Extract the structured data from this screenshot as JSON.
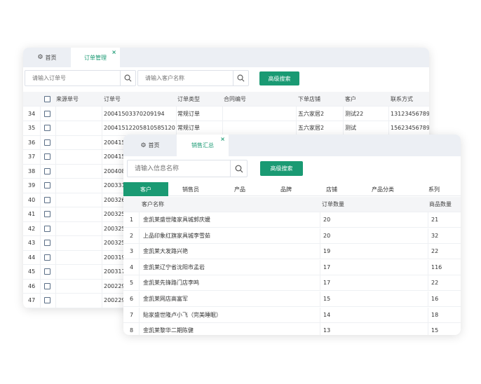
{
  "back_window": {
    "tabs": [
      {
        "label": "首页",
        "icon": "gear-icon",
        "active": false
      },
      {
        "label": "订单管理",
        "active": true,
        "closable": true
      }
    ],
    "order_search": {
      "placeholder": "请输入订单号"
    },
    "customer_search": {
      "placeholder": "请输入客户名称"
    },
    "advanced_search_label": "高级搜索",
    "table": {
      "columns": [
        "来源单号",
        "订单号",
        "订单类型",
        "合同编号",
        "下单店铺",
        "客户",
        "联系方式"
      ],
      "rows": [
        {
          "num": "34",
          "source": "",
          "order": "20041503370209194",
          "type": "常规订单",
          "contract": "",
          "store": "五六家居2",
          "customer": "测试22",
          "contact": "13123456789"
        },
        {
          "num": "35",
          "source": "",
          "order": "20041512205810585120 7",
          "type": "常规订单",
          "contract": "",
          "store": "五六家居2",
          "customer": "测试",
          "contact": "15623456789"
        },
        {
          "num": "36",
          "source": "",
          "order": "200415",
          "type": "",
          "contract": "",
          "store": "",
          "customer": "",
          "contact": ""
        },
        {
          "num": "37",
          "source": "",
          "order": "200415",
          "type": "",
          "contract": "",
          "store": "",
          "customer": "",
          "contact": ""
        },
        {
          "num": "38",
          "source": "",
          "order": "200408",
          "type": "",
          "contract": "",
          "store": "",
          "customer": "",
          "contact": ""
        },
        {
          "num": "39",
          "source": "",
          "order": "200331",
          "type": "",
          "contract": "",
          "store": "",
          "customer": "",
          "contact": ""
        },
        {
          "num": "40",
          "source": "",
          "order": "200326",
          "type": "",
          "contract": "",
          "store": "",
          "customer": "",
          "contact": ""
        },
        {
          "num": "41",
          "source": "",
          "order": "200325",
          "type": "",
          "contract": "",
          "store": "",
          "customer": "",
          "contact": ""
        },
        {
          "num": "42",
          "source": "",
          "order": "200325",
          "type": "",
          "contract": "",
          "store": "",
          "customer": "",
          "contact": ""
        },
        {
          "num": "43",
          "source": "",
          "order": "200325",
          "type": "",
          "contract": "",
          "store": "",
          "customer": "",
          "contact": ""
        },
        {
          "num": "44",
          "source": "",
          "order": "200319",
          "type": "",
          "contract": "",
          "store": "",
          "customer": "",
          "contact": ""
        },
        {
          "num": "45",
          "source": "",
          "order": "200317",
          "type": "",
          "contract": "",
          "store": "",
          "customer": "",
          "contact": ""
        },
        {
          "num": "46",
          "source": "",
          "order": "200229",
          "type": "",
          "contract": "",
          "store": "",
          "customer": "",
          "contact": ""
        },
        {
          "num": "47",
          "source": "",
          "order": "200229",
          "type": "",
          "contract": "",
          "store": "",
          "customer": "",
          "contact": ""
        }
      ]
    }
  },
  "front_window": {
    "tabs": [
      {
        "label": "首页",
        "icon": "gear-icon",
        "active": false
      },
      {
        "label": "销售汇总",
        "active": true,
        "closable": true
      }
    ],
    "search": {
      "placeholder": "请输入信息名称"
    },
    "advanced_search_label": "高级搜索",
    "subtabs": [
      "客户",
      "销售员",
      "产品",
      "品牌",
      "店铺",
      "产品分类",
      "系列"
    ],
    "active_subtab": 0,
    "table": {
      "columns": [
        "客户名称",
        "订单数量",
        "商品数量"
      ],
      "rows": [
        {
          "num": "1",
          "name": "金凯莱盛世隆家具城郭庆媛",
          "orders": "20",
          "items": "21"
        },
        {
          "num": "2",
          "name": "上品印象红旗家具城李雪茹",
          "orders": "20",
          "items": "32"
        },
        {
          "num": "3",
          "name": "金凯莱大发路兴艳",
          "orders": "19",
          "items": "22"
        },
        {
          "num": "4",
          "name": "金凯莱辽宁省沈阳市孟岩",
          "orders": "17",
          "items": "116"
        },
        {
          "num": "5",
          "name": "金凯莱先锋路门店李鸣",
          "orders": "17",
          "items": "22"
        },
        {
          "num": "6",
          "name": "金凯莱网店高富军",
          "orders": "15",
          "items": "16"
        },
        {
          "num": "7",
          "name": "貼家盛世隆卢小飞（完美睡眠）",
          "orders": "14",
          "items": "18"
        },
        {
          "num": "8",
          "name": "金凯莱黎华二期陈健",
          "orders": "13",
          "items": "15"
        }
      ]
    }
  },
  "colors": {
    "accent": "#1a9a73",
    "tabbar": "#eceff4",
    "header_bg": "#f4f5f7"
  }
}
